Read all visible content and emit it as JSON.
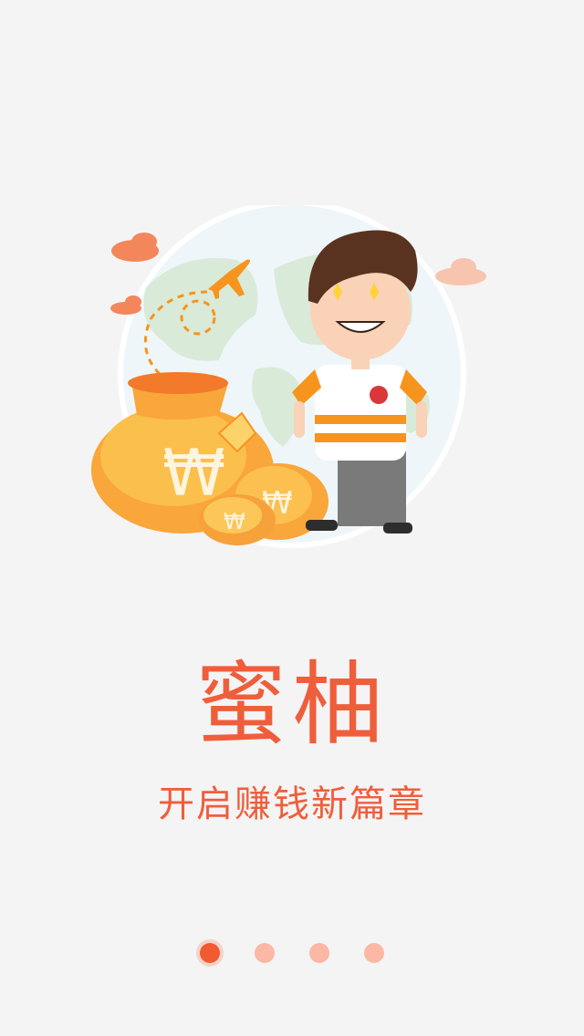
{
  "onboarding": {
    "title": "蜜柚",
    "subtitle": "开启赚钱新篇章",
    "illustration": {
      "description_icons": [
        "globe-icon",
        "airplane-icon",
        "cloud-icon",
        "money-bag-icon",
        "character-icon"
      ],
      "currency_symbol": "₩"
    },
    "pagination": {
      "total": 4,
      "current": 1
    }
  },
  "colors": {
    "background": "#f4f4f4",
    "accent": "#f0603a",
    "title": "#ef5e3b",
    "dot_active": "#f25a32",
    "dot_inactive": "#fbb8a5",
    "globe": "#eaf4f8",
    "land": "#d8e9d7",
    "bag": "#f9a63a",
    "bag_light": "#fcd36a",
    "cloud": "#f4865c",
    "stripe": "#f7941d"
  }
}
